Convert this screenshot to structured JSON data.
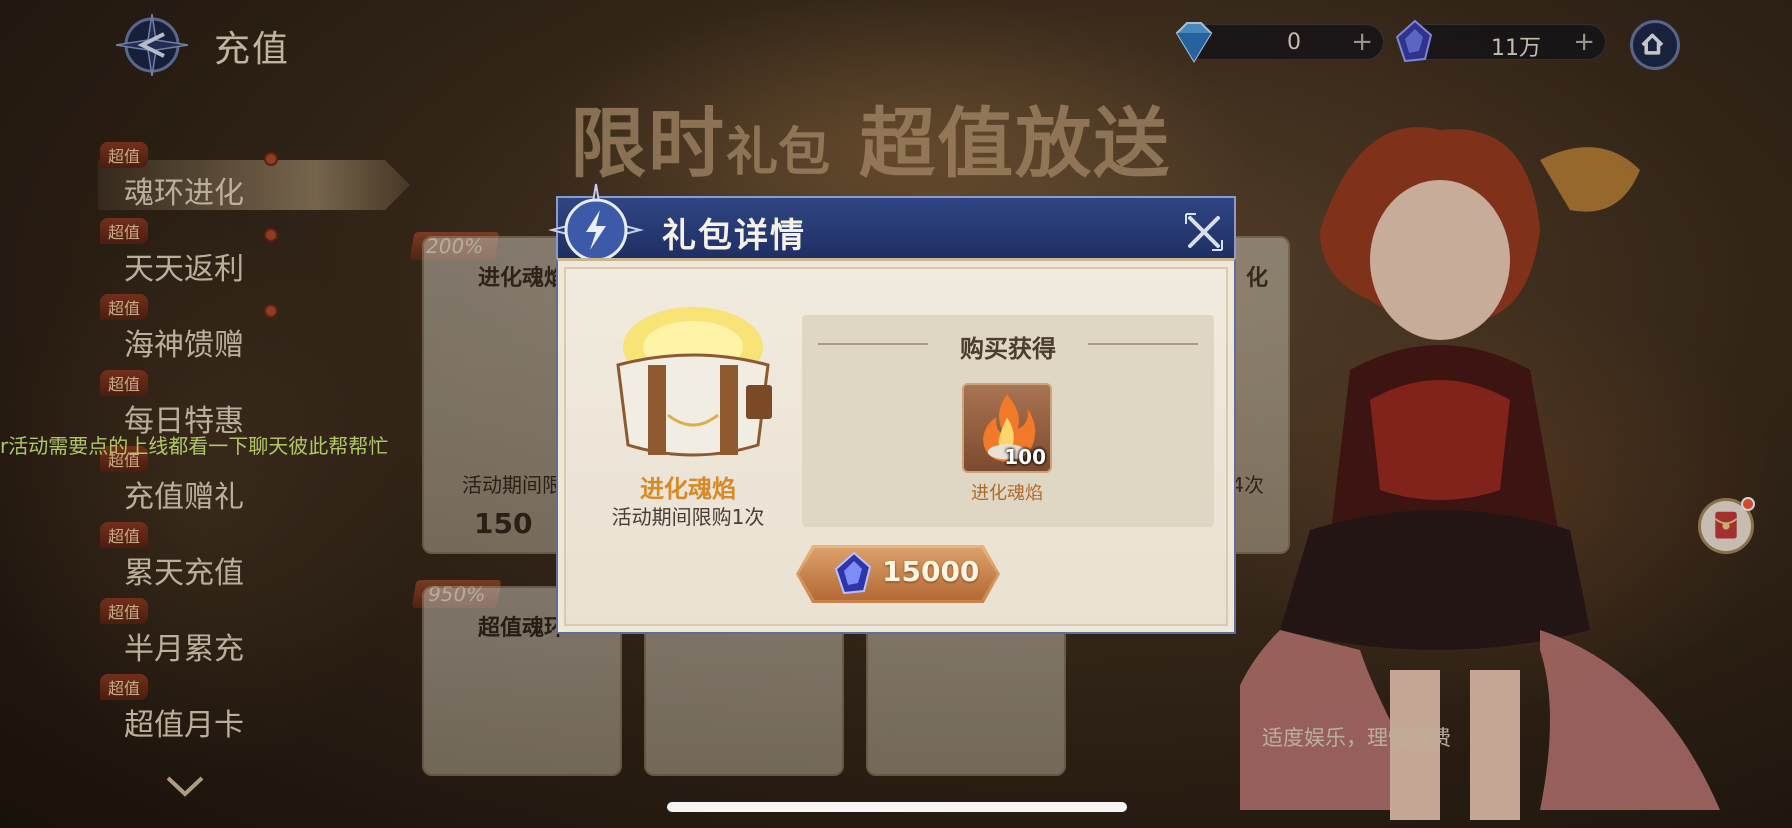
{
  "header": {
    "title": "充值",
    "diamond_value": "0",
    "crystal_value": "11万",
    "plus_symbol": "+"
  },
  "banner": {
    "part1": "限时",
    "part2": "礼包",
    "part3": "超值放送"
  },
  "sidebar": {
    "tag": "超值",
    "items": [
      {
        "label": "魂环进化"
      },
      {
        "label": "天天返利"
      },
      {
        "label": "海神馈赠"
      },
      {
        "label": "每日特惠"
      },
      {
        "label": "充值赠礼"
      },
      {
        "label": "累天充值"
      },
      {
        "label": "半月累充"
      },
      {
        "label": "超值月卡"
      }
    ]
  },
  "chat_ticker": "r活动需要点的上线都看一下聊天彼此帮帮忙",
  "cards": {
    "card1": {
      "badge": "200%",
      "title": "进化魂焰",
      "limit": "活动期间限购",
      "price": "150"
    },
    "card2": {
      "badge": "950%",
      "title": "超值魂环"
    },
    "card_right_title": "化",
    "card_right_limit": "4次"
  },
  "modal": {
    "title": "礼包详情",
    "item_name": "进化魂焰",
    "item_limit": "活动期间限购1次",
    "reward_header": "购买获得",
    "reward_name": "进化魂焰",
    "reward_count": "100",
    "price": "15000"
  },
  "slogan": "适度娱乐，理性消费"
}
